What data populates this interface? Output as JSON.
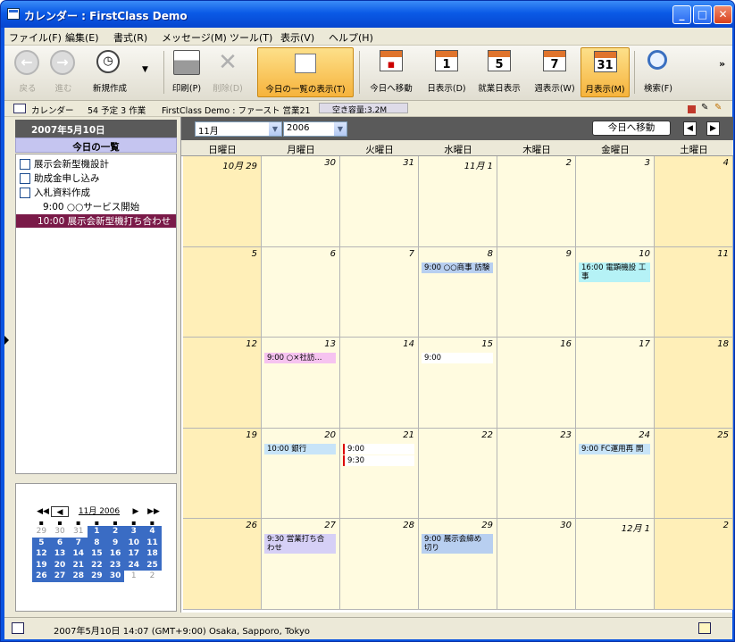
{
  "window": {
    "title": "カレンダー : FirstClass Demo",
    "min_icon": "minimize-icon",
    "max_icon": "maximize-icon",
    "close_icon": "close-icon"
  },
  "menu": [
    "ファイル(F)",
    "編集(E)",
    "書式(R)",
    "メッセージ(M)",
    "ツール(T)",
    "表示(V)",
    "ヘルプ(H)"
  ],
  "toolbar": {
    "back": "戻る",
    "forward": "進む",
    "new": "新規作成",
    "print": "印刷(P)",
    "delete": "削除(D)",
    "today_list": "今日の一覧の表示(T)",
    "goto_today": "今日へ移動",
    "day_view": "日表示(D)",
    "workweek_view": "就業日表示",
    "week_view": "週表示(W)",
    "month_view": "月表示(M)",
    "search": "検索(F)",
    "day_num": "1",
    "workweek_num": "5",
    "week_num": "7",
    "month_num": "31",
    "more": "»"
  },
  "pathbar": {
    "label": "カレンダー",
    "counts": "54 予定 3 作業",
    "location": "FirstClass Demo : ファースト 営業21",
    "space": "空き容量:3.2M"
  },
  "left": {
    "date": "2007年5月10日",
    "today_header": "今日の一覧",
    "todos": [
      "展示会新型機設計",
      "助成金申し込み",
      "入札資料作成"
    ],
    "item_plain": "9:00 ○○サービス開始",
    "item_selected": "10:00 展示会新型機打ち合わせ"
  },
  "minical": {
    "label": "11月 2006",
    "weeks": [
      [
        "29",
        "30",
        "31",
        "1",
        "2",
        "3",
        "4"
      ],
      [
        "5",
        "6",
        "7",
        "8",
        "9",
        "10",
        "11"
      ],
      [
        "12",
        "13",
        "14",
        "15",
        "16",
        "17",
        "18"
      ],
      [
        "19",
        "20",
        "21",
        "22",
        "23",
        "24",
        "25"
      ],
      [
        "26",
        "27",
        "28",
        "29",
        "30",
        "1",
        "2"
      ]
    ]
  },
  "calendar": {
    "month": "11月",
    "year": "2006",
    "today_button": "今日へ移動",
    "weekdays": [
      "日曜日",
      "月曜日",
      "火曜日",
      "水曜日",
      "木曜日",
      "金曜日",
      "土曜日"
    ],
    "weeks": [
      [
        "10月 29",
        "30",
        "31",
        "11月 1",
        "2",
        "3",
        "4"
      ],
      [
        "5",
        "6",
        "7",
        "8",
        "9",
        "10",
        "11"
      ],
      [
        "12",
        "13",
        "14",
        "15",
        "16",
        "17",
        "18"
      ],
      [
        "19",
        "20",
        "21",
        "22",
        "23",
        "24",
        "25"
      ],
      [
        "26",
        "27",
        "28",
        "29",
        "30",
        "12月 1",
        "2"
      ]
    ],
    "events": [
      {
        "week": 1,
        "day": 3,
        "text": "9:00 ○○商事 訪験",
        "color": "#b8cff0"
      },
      {
        "week": 1,
        "day": 5,
        "text": "16:00 電顕機設 工事",
        "color": "#b5f2f6"
      },
      {
        "week": 2,
        "day": 1,
        "text": "9:00 ○×社訪...",
        "color": "#f6c3f0"
      },
      {
        "week": 2,
        "day": 3,
        "text": "9:00",
        "color": "#ffffff"
      },
      {
        "week": 3,
        "day": 1,
        "text": "10:00 銀行",
        "color": "#c8e4f8"
      },
      {
        "week": 3,
        "day": 2,
        "text": "9:00",
        "color": "#ffffff"
      },
      {
        "week": 3,
        "day": 2,
        "text": "9:30",
        "color": "#ffffff"
      },
      {
        "week": 3,
        "day": 5,
        "text": "9:00 FC運用再 開",
        "color": "#c8e4f8"
      },
      {
        "week": 4,
        "day": 1,
        "text": "9:30 営業打ち合 わせ",
        "color": "#d6d0f6"
      },
      {
        "week": 4,
        "day": 3,
        "text": "9:00 展示会締め 切り",
        "color": "#b8cff0"
      }
    ]
  },
  "status": {
    "text": "2007年5月10日 14:07 (GMT+9:00) Osaka, Sapporo, Tokyo"
  }
}
